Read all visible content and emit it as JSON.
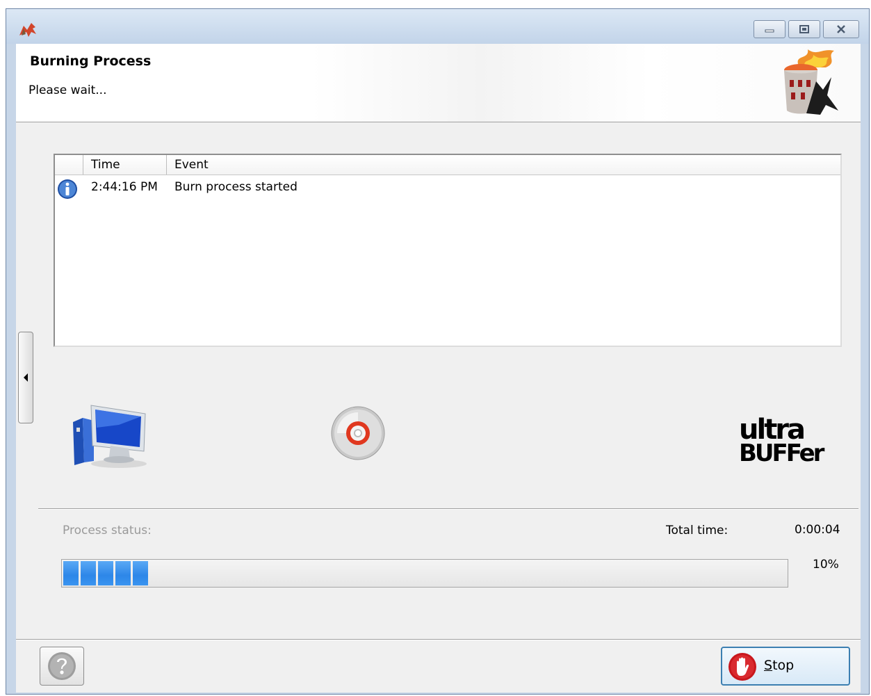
{
  "window": {
    "app_icon": "k3b-burner-icon",
    "controls": {
      "minimize": "minimize-icon",
      "maximize": "maximize-icon",
      "close": "close-icon"
    }
  },
  "header": {
    "title": "Burning Process",
    "subtitle": "Please wait..."
  },
  "log": {
    "columns": [
      "",
      "Time",
      "Event"
    ],
    "rows": [
      {
        "icon": "info-icon",
        "time": "2:44:16 PM",
        "event": "Burn process started"
      }
    ]
  },
  "status": {
    "process_status_label": "Process status:",
    "total_time_label": "Total time:",
    "total_time_value": "0:00:04",
    "progress_text": "10%",
    "progress_fraction": 0.1
  },
  "footer": {
    "stop_label_first": "S",
    "stop_label_rest": "top"
  },
  "colors": {
    "progress": "#2d86e8",
    "stop_red": "#c8171d",
    "stop_border": "#3c7fb1"
  }
}
